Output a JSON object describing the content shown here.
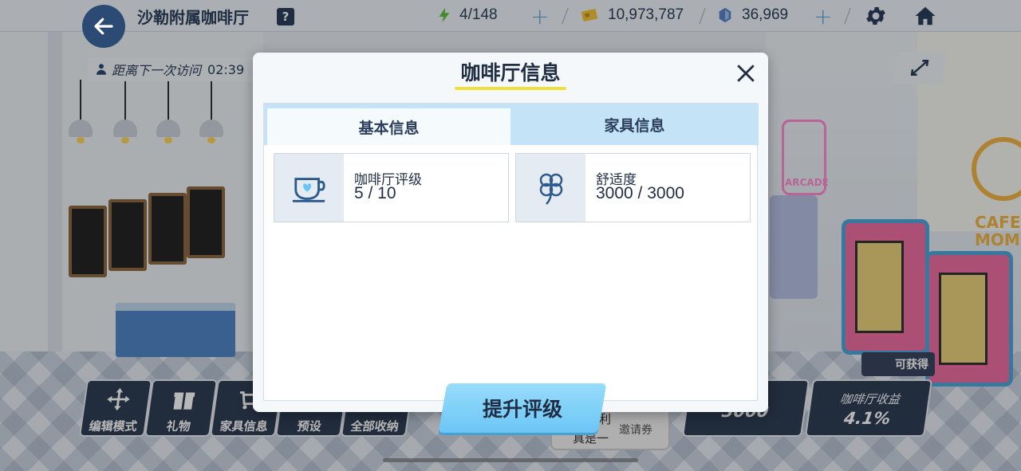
{
  "header": {
    "cafe_name": "沙勒附属咖啡厅",
    "help_label": "?",
    "energy": "4/148",
    "credits": "10,973,787",
    "gems": "36,969"
  },
  "visit_timer": {
    "label": "距离下一次访问",
    "time": "02:39"
  },
  "scene_signs": {
    "arcade": "ARCADE",
    "cafe_line1": "CAFE",
    "cafe_line2": "MOMO"
  },
  "toolbar": {
    "edit_mode": "编辑模式",
    "gift": "礼物",
    "furniture_info": "家具信息",
    "preset": "预设",
    "collect_all": "全部收纳"
  },
  "stats": {
    "comfort_value": "3000",
    "income_label": "咖啡厅收益",
    "income_value": "4.1%",
    "can_get": "可获得"
  },
  "speech": {
    "line1": "便利",
    "line2": "真是一",
    "invite": "邀请券"
  },
  "dialog": {
    "title": "咖啡厅信息",
    "tabs": [
      "基本信息",
      "家具信息"
    ],
    "active_tab": "基本信息",
    "cards": [
      {
        "label": "咖啡厅评级",
        "value": "5 / 10",
        "icon": "coffee-cup-icon"
      },
      {
        "label": "舒适度",
        "value": "3000 / 3000",
        "icon": "clover-icon"
      }
    ],
    "upgrade_button": "提升评级"
  },
  "colors": {
    "accent_blue": "#6cc6f5",
    "tab_bg": "#c4e3f6",
    "title_underline": "#f3df3a",
    "hud_dark": "#2f3d55"
  }
}
